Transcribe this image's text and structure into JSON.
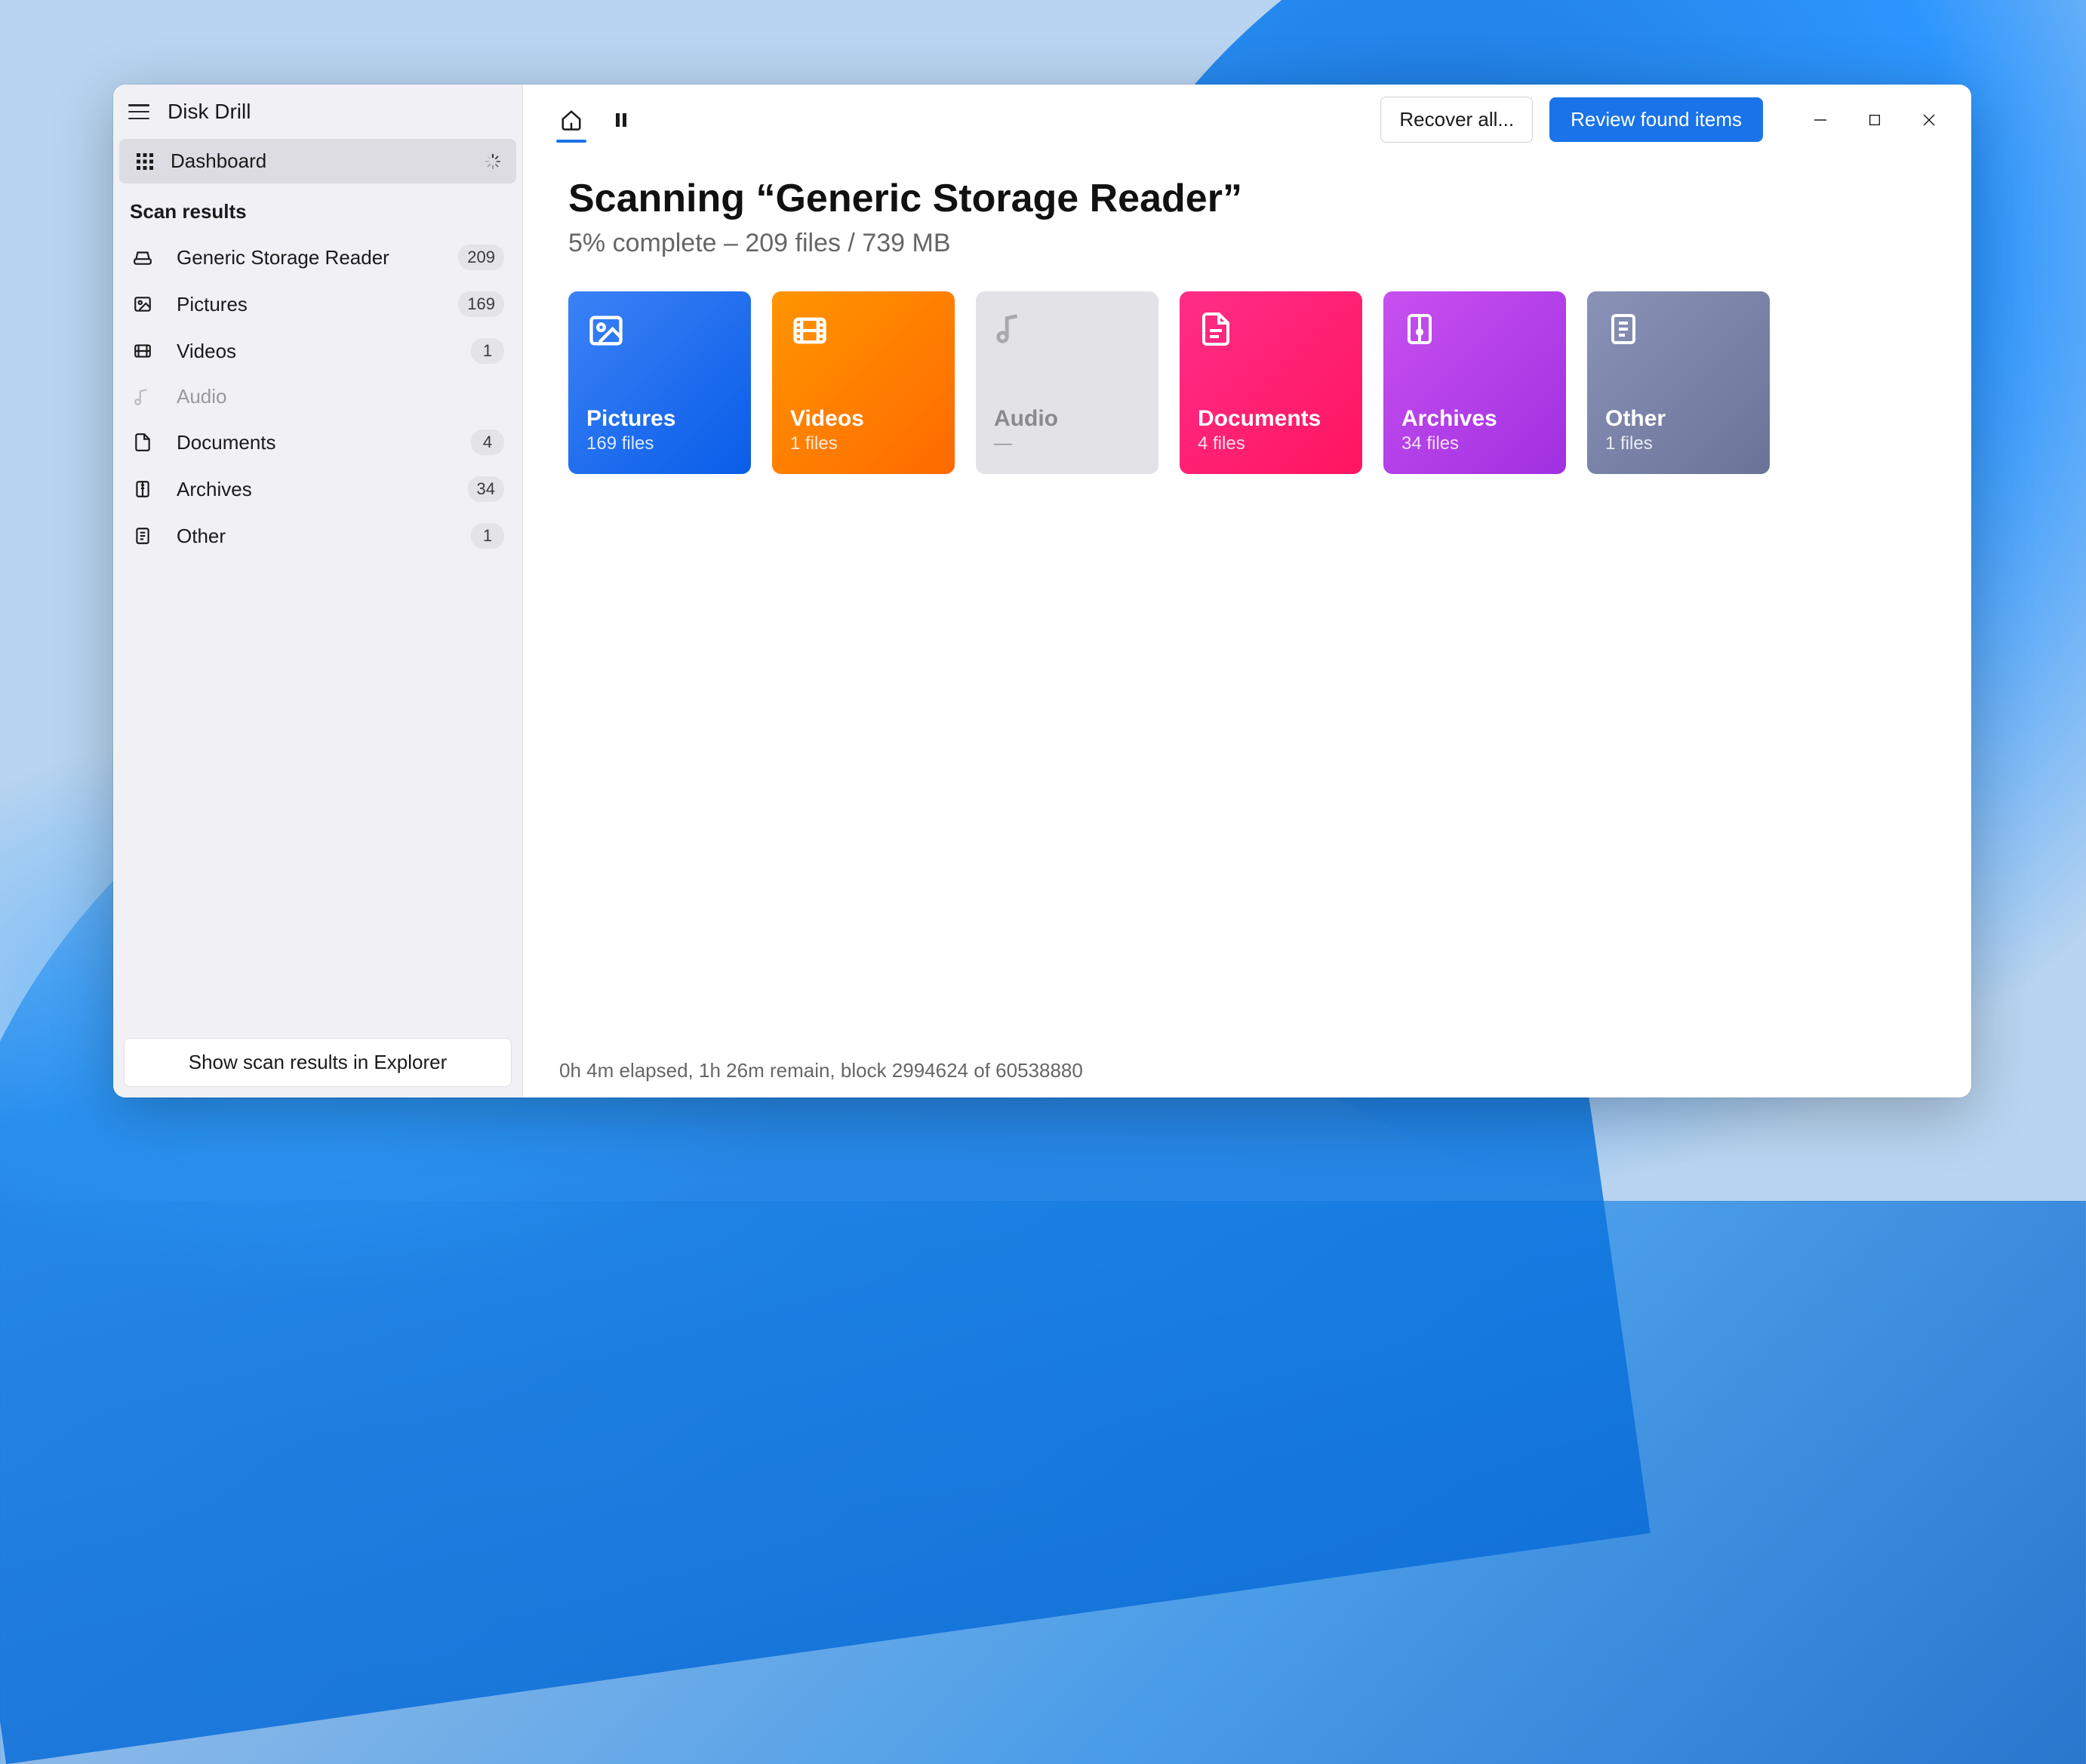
{
  "app": {
    "title": "Disk Drill"
  },
  "sidebar": {
    "dashboard_label": "Dashboard",
    "section_label": "Scan results",
    "items": [
      {
        "label": "Generic Storage Reader",
        "count": "209"
      },
      {
        "label": "Pictures",
        "count": "169"
      },
      {
        "label": "Videos",
        "count": "1"
      },
      {
        "label": "Audio",
        "count": ""
      },
      {
        "label": "Documents",
        "count": "4"
      },
      {
        "label": "Archives",
        "count": "34"
      },
      {
        "label": "Other",
        "count": "1"
      }
    ],
    "explorer_button": "Show scan results in Explorer"
  },
  "toolbar": {
    "recover_label": "Recover all...",
    "review_label": "Review found items"
  },
  "main": {
    "title": "Scanning “Generic Storage Reader”",
    "subtitle": "5% complete – 209 files / 739 MB"
  },
  "cards": [
    {
      "title": "Pictures",
      "sub": "169 files"
    },
    {
      "title": "Videos",
      "sub": "1 files"
    },
    {
      "title": "Audio",
      "sub": "—"
    },
    {
      "title": "Documents",
      "sub": "4 files"
    },
    {
      "title": "Archives",
      "sub": "34 files"
    },
    {
      "title": "Other",
      "sub": "1 files"
    }
  ],
  "status": "0h 4m elapsed, 1h 26m remain, block 2994624 of 60538880"
}
